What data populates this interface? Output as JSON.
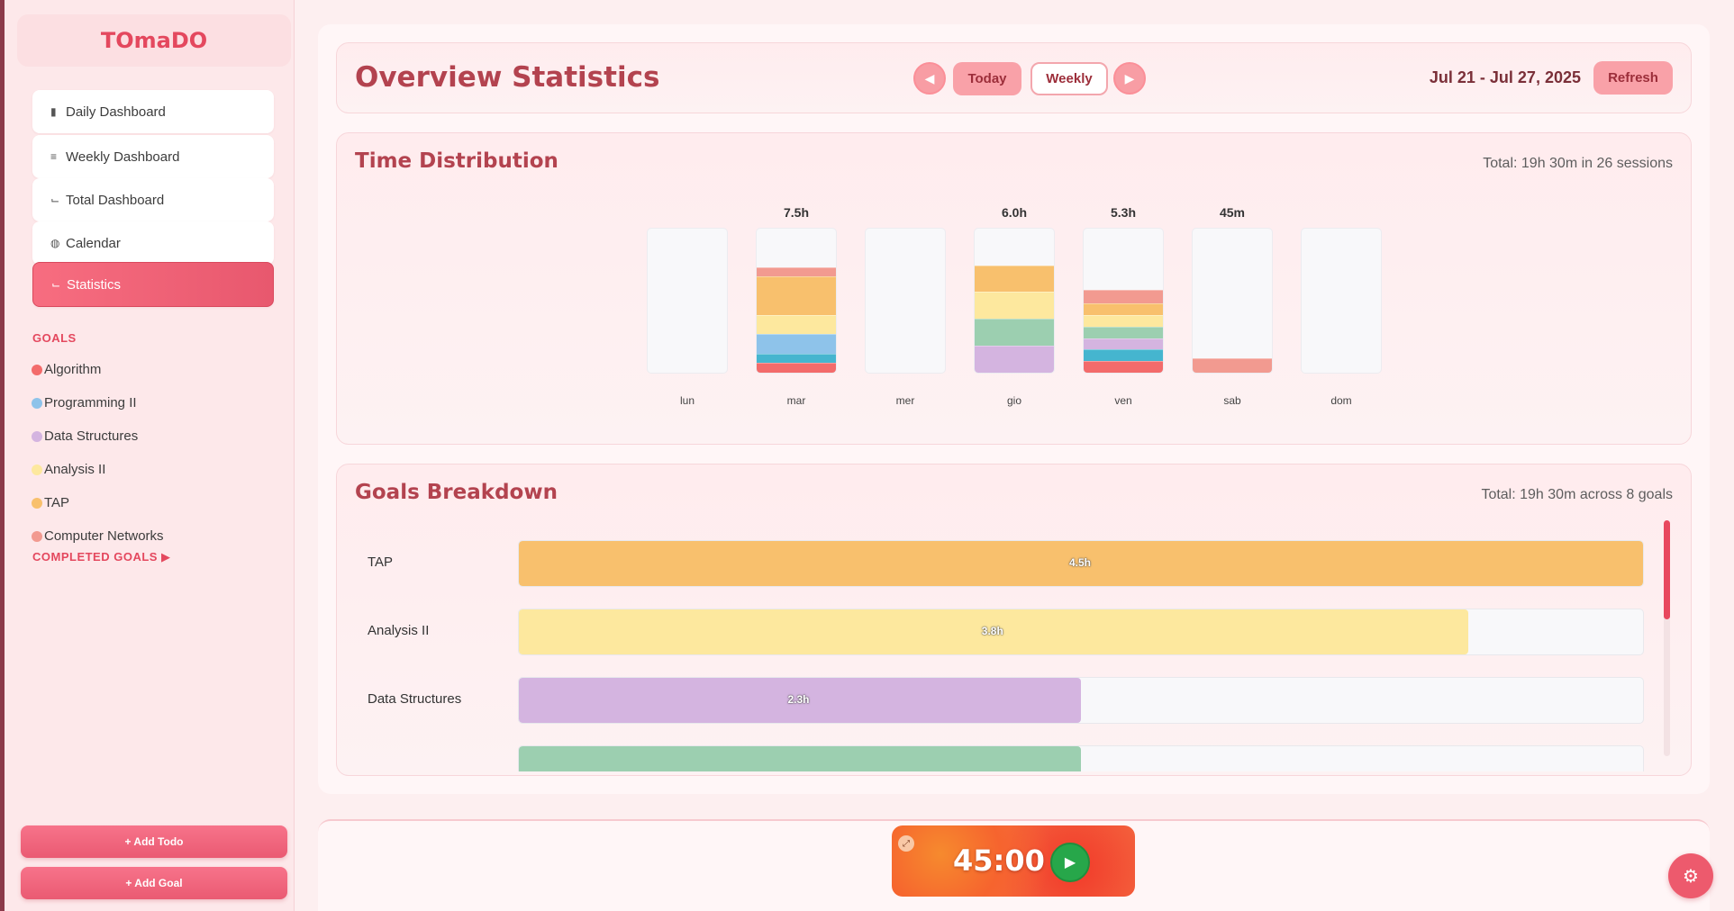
{
  "app": {
    "name": "TOmaDO"
  },
  "sidebar": {
    "nav": [
      {
        "label": "Daily Dashboard",
        "icon": "bar-chart-icon",
        "glyph": "📊"
      },
      {
        "label": "Weekly Dashboard",
        "icon": "list-icon",
        "glyph": "≡"
      },
      {
        "label": "Total Dashboard",
        "icon": "trend-icon",
        "glyph": "📈"
      },
      {
        "label": "Calendar",
        "icon": "globe-icon",
        "glyph": "◍"
      },
      {
        "label": "Statistics",
        "icon": "line-chart-icon",
        "glyph": "📈"
      }
    ],
    "goals_title": "GOALS",
    "goals": [
      {
        "label": "Algorithm",
        "color": "#f36b6b"
      },
      {
        "label": "Programming II",
        "color": "#8ec3ea"
      },
      {
        "label": "Data Structures",
        "color": "#d4b4e0"
      },
      {
        "label": "Analysis II",
        "color": "#fde89e"
      },
      {
        "label": "TAP",
        "color": "#f8c06d"
      },
      {
        "label": "Computer Networks",
        "color": "#f29a90"
      }
    ],
    "completed_goals": "COMPLETED GOALS ▶",
    "add_todo": "+ Add Todo",
    "add_goal": "+ Add Goal"
  },
  "header": {
    "title": "Overview Statistics",
    "prev": "◀",
    "today": "Today",
    "weekly": "Weekly",
    "next": "▶",
    "date_range": "Jul 21 - Jul 27, 2025",
    "refresh": "Refresh"
  },
  "time_distribution": {
    "title": "Time Distribution",
    "total": "Total: 19h 30m in 26 sessions"
  },
  "chart_data": {
    "type": "bar",
    "stacked": true,
    "categories": [
      "lun",
      "mar",
      "mer",
      "gio",
      "ven",
      "sab",
      "dom"
    ],
    "totals_labels": [
      "",
      "7.5h",
      "",
      "6.0h",
      "5.3h",
      "45m",
      ""
    ],
    "totals_hours": [
      0,
      7.5,
      0,
      6.0,
      5.3,
      0.75,
      0
    ],
    "max_hours": 7.5,
    "series": [
      {
        "color": "#f36b6b",
        "values": [
          0,
          0.5,
          0,
          0,
          0.6,
          0,
          0
        ]
      },
      {
        "color": "#45b5cf",
        "values": [
          0,
          0.5,
          0,
          0,
          0.6,
          0,
          0
        ]
      },
      {
        "color": "#8ec3ea",
        "values": [
          0,
          1.0,
          0,
          0,
          0,
          0,
          0
        ]
      },
      {
        "color": "#d4b4e0",
        "values": [
          0,
          0,
          0,
          1.4,
          0.6,
          0,
          0
        ]
      },
      {
        "color": "#9ccfb0",
        "values": [
          0,
          0,
          0,
          1.4,
          0.6,
          0,
          0
        ]
      },
      {
        "color": "#fde89e",
        "values": [
          0,
          1.0,
          0,
          1.4,
          0.6,
          0,
          0
        ]
      },
      {
        "color": "#f8c06d",
        "values": [
          0,
          2.0,
          0,
          1.4,
          0.6,
          0,
          0
        ]
      },
      {
        "color": "#f29a90",
        "values": [
          0,
          0.5,
          0,
          0,
          0.7,
          0.75,
          0
        ]
      }
    ]
  },
  "goals_breakdown": {
    "title": "Goals Breakdown",
    "total": "Total: 19h 30m across 8 goals",
    "max_hours": 4.5,
    "rows": [
      {
        "name": "TAP",
        "value_label": "4.5h",
        "hours": 4.5,
        "color": "#f8c06d"
      },
      {
        "name": "Analysis II",
        "value_label": "3.8h",
        "hours": 3.8,
        "color": "#fde89e"
      },
      {
        "name": "Data Structures",
        "value_label": "2.3h",
        "hours": 2.25,
        "color": "#d4b4e0"
      },
      {
        "name": "",
        "value_label": "",
        "hours": 2.25,
        "color": "#9ccfb0"
      }
    ]
  },
  "timer": {
    "time": "45:00",
    "play": "▶",
    "expand": "⤢"
  },
  "settings": {
    "glyph": "⚙"
  }
}
